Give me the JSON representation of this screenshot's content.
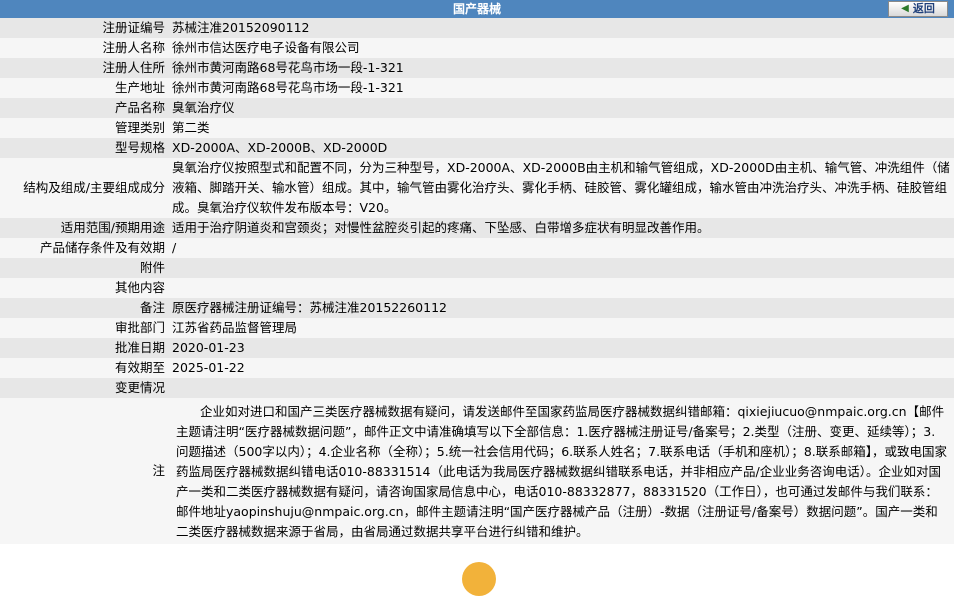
{
  "header": {
    "title": "国产器械",
    "back_label": "返回",
    "back_icon": "arrow-left-icon"
  },
  "rows": [
    {
      "label": "注册证编号",
      "value": "苏械注准20152090112"
    },
    {
      "label": "注册人名称",
      "value": "徐州市信达医疗电子设备有限公司"
    },
    {
      "label": "注册人住所",
      "value": "徐州市黄河南路68号花鸟市场一段-1-321"
    },
    {
      "label": "生产地址",
      "value": "徐州市黄河南路68号花鸟市场一段-1-321"
    },
    {
      "label": "产品名称",
      "value": "臭氧治疗仪"
    },
    {
      "label": "管理类别",
      "value": "第二类"
    },
    {
      "label": "型号规格",
      "value": "XD-2000A、XD-2000B、XD-2000D"
    },
    {
      "label": "结构及组成/主要组成成分",
      "value": "臭氧治疗仪按照型式和配置不同，分为三种型号，XD-2000A、XD-2000B由主机和输气管组成，XD-2000D由主机、输气管、冲洗组件（储液箱、脚踏开关、输水管）组成。其中，输气管由雾化治疗头、雾化手柄、硅胶管、雾化罐组成，输水管由冲洗治疗头、冲洗手柄、硅胶管组成。臭氧治疗仪软件发布版本号：V20。"
    },
    {
      "label": "适用范围/预期用途",
      "value": "适用于治疗阴道炎和宫颈炎；对慢性盆腔炎引起的疼痛、下坠感、白带增多症状有明显改善作用。"
    },
    {
      "label": "产品储存条件及有效期",
      "value": "/"
    },
    {
      "label": "附件",
      "value": ""
    },
    {
      "label": "其他内容",
      "value": ""
    },
    {
      "label": "备注",
      "value": "原医疗器械注册证编号：苏械注准20152260112"
    },
    {
      "label": "审批部门",
      "value": "江苏省药品监督管理局"
    },
    {
      "label": "批准日期",
      "value": "2020-01-23"
    },
    {
      "label": "有效期至",
      "value": "2025-01-22"
    },
    {
      "label": "变更情况",
      "value": ""
    }
  ],
  "note": {
    "label": "注",
    "text": "企业如对进口和国产三类医疗器械数据有疑问，请发送邮件至国家药监局医疗器械数据纠错邮箱：qixiejiucuo@nmpaic.org.cn【邮件主题请注明“医疗器械数据问题”，邮件正文中请准确填写以下全部信息：1.医疗器械注册证号/备案号；2.类型（注册、变更、延续等）；3.问题描述（500字以内）；4.企业名称（全称）；5.统一社会信用代码；6.联系人姓名；7.联系电话（手机和座机）；8.联系邮箱】，或致电国家药监局医疗器械数据纠错电话010-88331514（此电话为我局医疗器械数据纠错联系电话，并非相应产品/企业业务咨询电话）。企业如对国产一类和二类医疗器械数据有疑问，请咨询国家局信息中心，电话010-88332877，88331520（工作日），也可通过发邮件与我们联系：邮件地址yaopinshuju@nmpaic.org.cn，邮件主题请注明“国产医疗器械产品（注册）-数据（注册证号/备案号）数据问题”。国产一类和二类医疗器械数据来源于省局，由省局通过数据共享平台进行纠错和维护。"
  }
}
